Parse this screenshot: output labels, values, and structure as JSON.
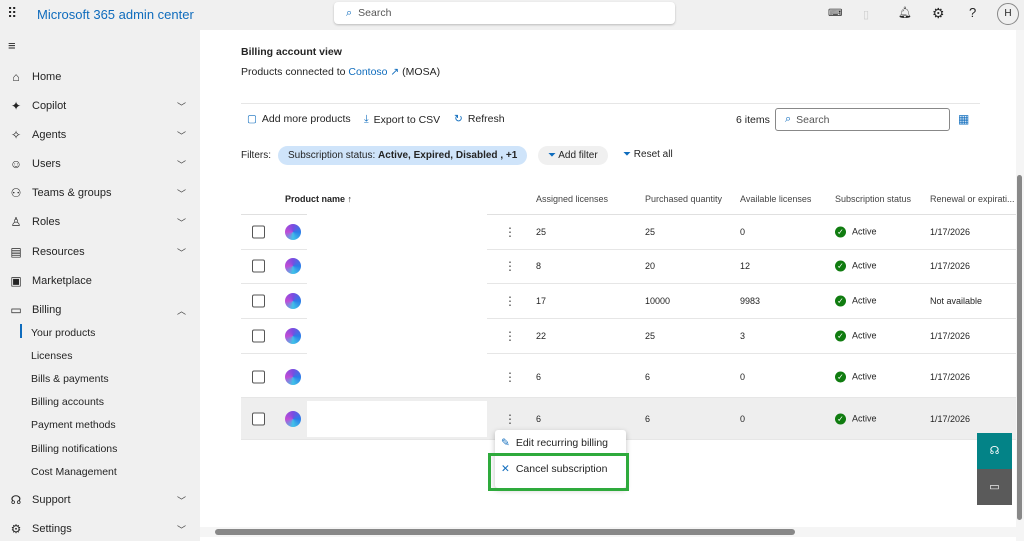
{
  "header": {
    "app_title": "Microsoft 365 admin center",
    "search_placeholder": "Search",
    "avatar": "H"
  },
  "sidebar": {
    "items": [
      {
        "label": "Home",
        "icon": "home-icon",
        "chevron": false
      },
      {
        "label": "Copilot",
        "icon": "copilot-icon",
        "chevron": true
      },
      {
        "label": "Agents",
        "icon": "agents-icon",
        "chevron": true
      },
      {
        "label": "Users",
        "icon": "user-icon",
        "chevron": true
      },
      {
        "label": "Teams & groups",
        "icon": "teams-icon",
        "chevron": true
      },
      {
        "label": "Roles",
        "icon": "roles-icon",
        "chevron": true
      },
      {
        "label": "Resources",
        "icon": "resources-icon",
        "chevron": true
      },
      {
        "label": "Marketplace",
        "icon": "marketplace-icon",
        "chevron": false
      },
      {
        "label": "Billing",
        "icon": "billing-icon",
        "chevron": true
      }
    ],
    "billing_sub": [
      "Your products",
      "Licenses",
      "Bills & payments",
      "Billing accounts",
      "Payment methods",
      "Billing notifications",
      "Cost Management"
    ],
    "bottom": [
      {
        "label": "Support",
        "icon": "support-icon"
      },
      {
        "label": "Settings",
        "icon": "gear-icon"
      }
    ]
  },
  "main": {
    "view_title": "Billing account view",
    "connected_prefix": "Products connected to",
    "connected_link": "Contoso",
    "connected_suffix": "(MOSA)",
    "toolbar": {
      "add": "Add more products",
      "export": "Export to CSV",
      "refresh": "Refresh",
      "count": "6 items",
      "search_placeholder": "Search"
    },
    "filters": {
      "label": "Filters:",
      "chip_prefix": "Subscription status:",
      "chip_value": "Active, Expired, Disabled , +1",
      "add": "Add filter",
      "reset": "Reset all"
    },
    "columns": [
      "Product name",
      "Assigned licenses",
      "Purchased quantity",
      "Available licenses",
      "Subscription status",
      "Renewal or expirati..."
    ],
    "rows": [
      {
        "assigned": "25",
        "purchased": "25",
        "available": "0",
        "status": "Active",
        "renewal": "1/17/2026"
      },
      {
        "assigned": "8",
        "purchased": "20",
        "available": "12",
        "status": "Active",
        "renewal": "1/17/2026"
      },
      {
        "assigned": "17",
        "purchased": "10000",
        "available": "9983",
        "status": "Active",
        "renewal": "Not available"
      },
      {
        "assigned": "22",
        "purchased": "25",
        "available": "3",
        "status": "Active",
        "renewal": "1/17/2026"
      },
      {
        "assigned": "6",
        "purchased": "6",
        "available": "0",
        "status": "Active",
        "renewal": "1/17/2026"
      },
      {
        "assigned": "6",
        "purchased": "6",
        "available": "0",
        "status": "Active",
        "renewal": "1/17/2026"
      }
    ],
    "context_menu": {
      "edit": "Edit recurring billing",
      "cancel": "Cancel subscription"
    }
  },
  "colors": {
    "accent": "#0f6cbd",
    "highlight": "#2eaa3c",
    "teal": "#038387"
  }
}
